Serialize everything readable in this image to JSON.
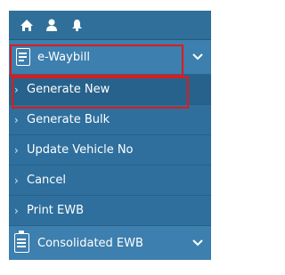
{
  "topbar": {
    "icons": [
      "home-icon",
      "user-icon",
      "bell-icon"
    ]
  },
  "menu": {
    "ewaybill_label": "e-Waybill",
    "items": [
      {
        "label": "Generate New",
        "active": true
      },
      {
        "label": "Generate Bulk"
      },
      {
        "label": "Update Vehicle No"
      },
      {
        "label": "Cancel"
      },
      {
        "label": "Print EWB"
      }
    ],
    "consolidated_label": "Consolidated EWB"
  },
  "colors": {
    "accent": "#2e6f9d",
    "header": "#3d7fae",
    "highlight": "#e01a1a"
  }
}
